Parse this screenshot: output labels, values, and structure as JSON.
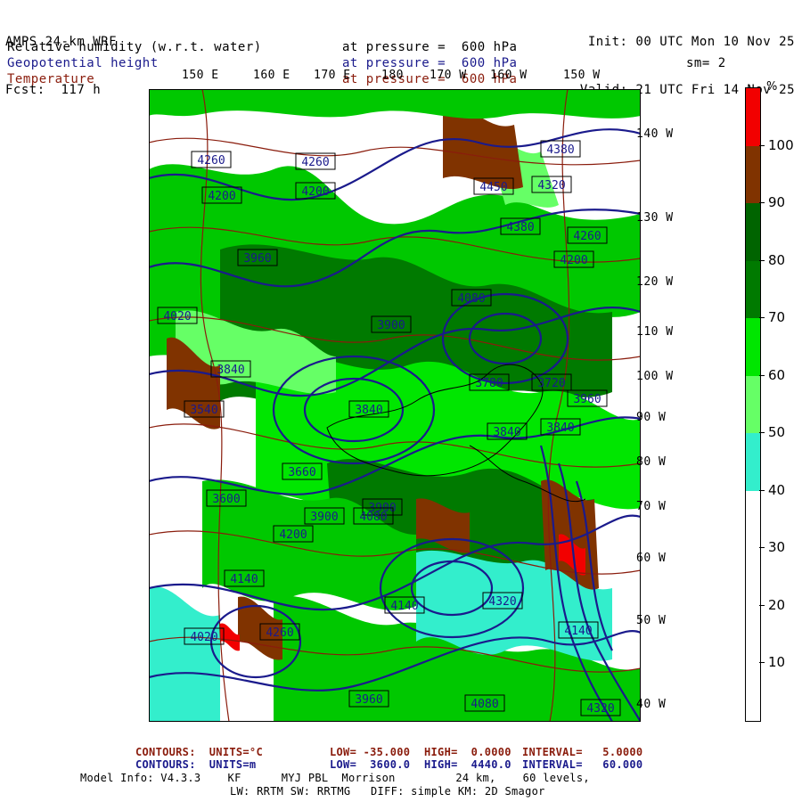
{
  "header": {
    "model": "AMPS 24-km WRF",
    "fcst": "Fcst:  117 h",
    "init": "Init: 00 UTC Mon 10 Nov 25",
    "valid": "Valid: 21 UTC Fri 14 Nov 25"
  },
  "fields": [
    {
      "name": "Relative humidity (w.r.t. water)",
      "level": "at pressure =  600 hPa",
      "color": "#000000"
    },
    {
      "name": "Geopotential height",
      "level": "at pressure =  600 hPa",
      "color": "#1a1a8c"
    },
    {
      "name": "Temperature",
      "level": "at pressure =  600 hPa",
      "color": "#8a1c0c"
    }
  ],
  "smoothing": "sm= 2",
  "longitude_labels": [
    "150 E",
    "160 E",
    "170 E",
    "180",
    "170 W",
    "160 W",
    "150 W"
  ],
  "latitude_labels": [
    "140 W",
    "130 W",
    "120 W",
    "110 W",
    "100 W",
    "90 W",
    "80 W",
    "70 W",
    "60 W",
    "50 W",
    "40 W"
  ],
  "height_labels": [
    "4260",
    "4260",
    "4200",
    "4200",
    "4380",
    "4450",
    "4320",
    "4380",
    "4080",
    "4020",
    "3900",
    "3960",
    "3840",
    "3780",
    "3720",
    "3660",
    "3600",
    "3540",
    "3840",
    "3900",
    "4080",
    "4140",
    "4320",
    "4200",
    "4260",
    "4140",
    "4080",
    "4020",
    "3960",
    "3900",
    "3840",
    "4320",
    "4260",
    "4200",
    "4140",
    "3960",
    "3840"
  ],
  "colorbar": {
    "unit": "%",
    "labels": [
      "100",
      "90",
      "80",
      "70",
      "60",
      "50",
      "40",
      "30",
      "20",
      "10"
    ],
    "colors": [
      "#f20000",
      "#803300",
      "#006400",
      "#007a00",
      "#00e600",
      "#66ff66",
      "#33eecc",
      "#ffffff",
      "#ffffff",
      "#ffffff",
      "#ffffff"
    ]
  },
  "footer": {
    "temp_contours": {
      "label": "CONTOURS:  UNITS=°C",
      "low": "LOW= -35.000",
      "high": "HIGH=  0.0000",
      "interval": "INTERVAL=   5.0000"
    },
    "height_contours": {
      "label": "CONTOURS:  UNITS=m",
      "low": "LOW=  3600.0",
      "high": "HIGH=  4440.0",
      "interval": "INTERVAL=   60.000"
    },
    "model_info": "Model Info: V4.3.3    KF      MYJ PBL  Morrison         24 km,    60 levels,",
    "model_info2": "LW: RRTM SW: RRTMG   DIFF: simple KM: 2D Smagor"
  },
  "colors": {
    "temperature": "#8a1c0c",
    "height": "#1a1a8c",
    "text": "#000000"
  }
}
